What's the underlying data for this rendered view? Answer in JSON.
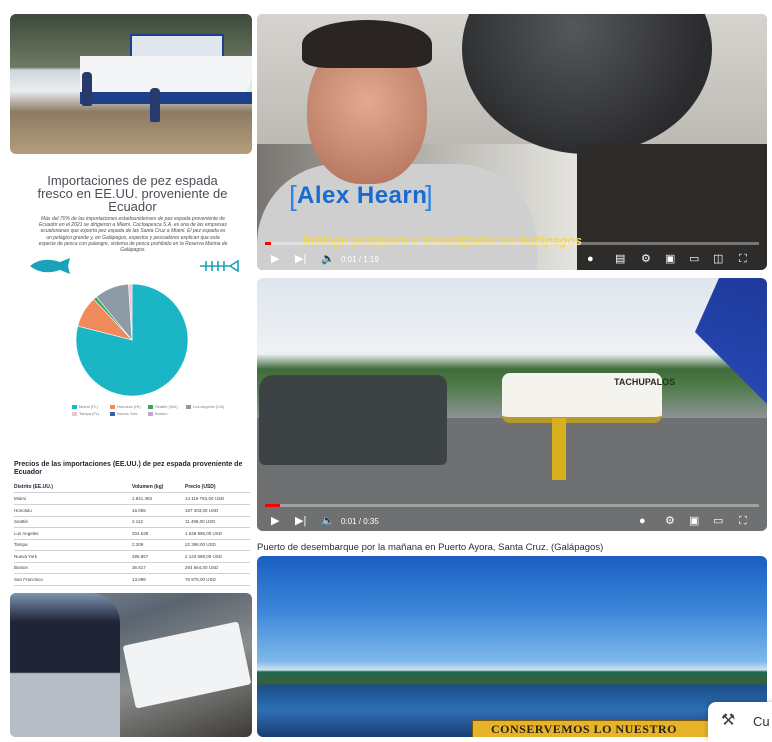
{
  "infographic": {
    "title": "Importaciones de pez espada fresco en EE.UU. proveniente de Ecuador",
    "body": "Más del 70% de las importaciones estadounidenses de pez espada proveniente de Ecuador en el 2021 se dirigieron a Miami. Cocloapesca S.A. es una de las empresas ecuatorianas que exporta pez espada de las Santa Cruz a Miami. El pez espada es un pelágico grande y, en Galápagos, expertos y pescadores explican que esta especie de pesca con palangre, sistema de pesca prohibido en la Reserva Marina de Galápagos.",
    "icons": [
      "tuna-fish-icon",
      "fish-skeleton-icon"
    ],
    "chart_data": {
      "type": "pie",
      "slices": [
        {
          "label": "Miami (FL)",
          "value": 79,
          "color": "#1bb6c6"
        },
        {
          "label": "Honolulu (HI)",
          "value": 9,
          "color": "#f08a5d"
        },
        {
          "label": "Seattle (WA)",
          "value": 1,
          "color": "#3aa65a"
        },
        {
          "label": "Los Angeles (CA)",
          "value": 10,
          "color": "#8e9aa6"
        },
        {
          "label": "Tampa (FL)",
          "value": 1,
          "color": "#f2c3cf"
        }
      ]
    },
    "legend": [
      "Miami (FL)",
      "Honolulu (HI)",
      "Seattle (WA)",
      "Los Angeles (CA)",
      "Tampa (FL)",
      "Nueva York",
      "Boston"
    ]
  },
  "price_table": {
    "title": "Precios de las importaciones (EE.UU.) de pez espada proveniente de Ecuador",
    "headers": [
      "Distrito (EE.UU.)",
      "Volumen (kg)",
      "Precio (USD)"
    ],
    "rows": [
      [
        "Miami",
        "1.841.383",
        "14 119 783,00 USD"
      ],
      [
        "Honolulu",
        "16.065",
        "167 403,00 USD"
      ],
      [
        "Seattle",
        "2.112",
        "11 498,00 USD"
      ],
      [
        "Los Angeles",
        "204.638",
        "1 648 995,00 USD"
      ],
      [
        "Tampa",
        "2.209",
        "22 398,00 USD"
      ],
      [
        "Nueva York",
        "286.857",
        "2 123 688,00 USD"
      ],
      [
        "Boston",
        "36.817",
        "264 564,00 USD"
      ],
      [
        "San Francisco",
        "13.098",
        "76 875,00 USD"
      ]
    ]
  },
  "video1": {
    "name_overlay": "Alex Hearn",
    "role_overlay": "Biólogo pesquero e investigador en Galápagos",
    "time": "0:01 / 1:19",
    "progress": 0.013
  },
  "video2": {
    "time": "0:01 / 0:35",
    "progress": 0.03,
    "bus_sign": "TACHUPALOS"
  },
  "caption": "Puerto de desembarque por la mañana en Puerto Ayora, Santa Cruz. (Galápagos)",
  "bay_sign": "CONSERVEMOS LO NUESTRO",
  "tool_button": {
    "label": "Cu",
    "icon": "tools-icon"
  }
}
